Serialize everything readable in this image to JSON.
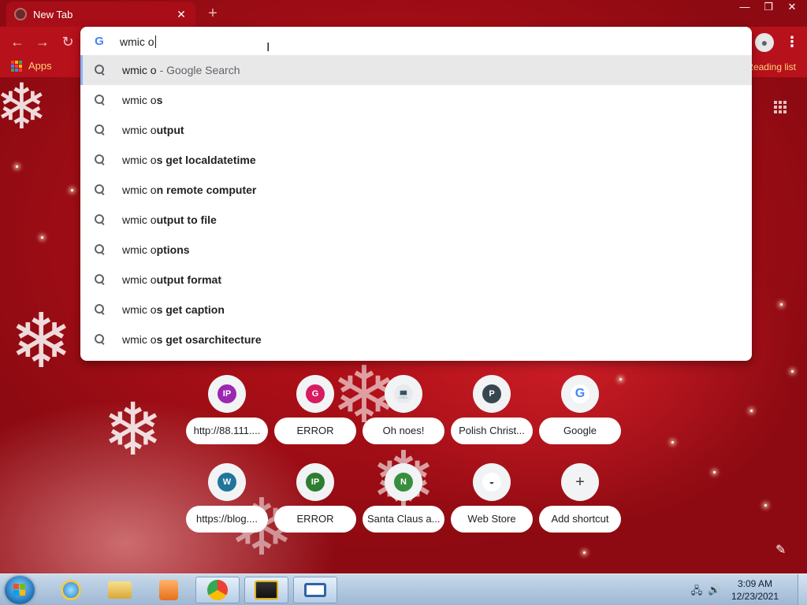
{
  "browser": {
    "tab": {
      "title": "New Tab",
      "close_label": "✕"
    },
    "new_tab_label": "+",
    "window_controls": {
      "minimize": "—",
      "maximize": "❐",
      "close": "✕"
    },
    "nav": {
      "back": "←",
      "forward": "→",
      "reload": "↻"
    },
    "profile_glyph": "●",
    "menu_glyph": "⋮"
  },
  "bookmarks": {
    "apps_label": "Apps",
    "reading_list_label": "Reading list"
  },
  "omnibox": {
    "google_glyph": "G",
    "value": "wmic o",
    "suggestions": [
      {
        "base": "wmic o",
        "rest": "",
        "suffix": "- Google Search",
        "selected": true
      },
      {
        "base": "wmic o",
        "rest": "s"
      },
      {
        "base": "wmic o",
        "rest": "utput"
      },
      {
        "base": "wmic o",
        "rest": "s get localdatetime"
      },
      {
        "base": "wmic o",
        "rest": "n remote computer"
      },
      {
        "base": "wmic o",
        "rest": "utput to file"
      },
      {
        "base": "wmic o",
        "rest": "ptions"
      },
      {
        "base": "wmic o",
        "rest": "utput format"
      },
      {
        "base": "wmic o",
        "rest": "s get caption"
      },
      {
        "base": "wmic o",
        "rest": "s get osarchitecture"
      }
    ]
  },
  "shortcuts": [
    {
      "label": "http://88.111....",
      "glyph": "IP",
      "color": "#9c27b0"
    },
    {
      "label": "ERROR",
      "glyph": "G",
      "color": "#d81b60"
    },
    {
      "label": "Oh noes!",
      "glyph": "💻",
      "color": "#e8eaed"
    },
    {
      "label": "Polish Christ...",
      "glyph": "P",
      "color": "#37474f"
    },
    {
      "label": "Google",
      "glyph": "G",
      "color": "#ffffff"
    },
    {
      "label": "https://blog....",
      "glyph": "W",
      "color": "#21759b"
    },
    {
      "label": "ERROR",
      "glyph": "IP",
      "color": "#2e7d32"
    },
    {
      "label": "Santa Claus a...",
      "glyph": "N",
      "color": "#388e3c"
    },
    {
      "label": "Web Store",
      "glyph": "◒",
      "color": "#ffffff"
    },
    {
      "label": "Add shortcut",
      "glyph": "+",
      "color": "#f1f3f4"
    }
  ],
  "taskbar": {
    "clock_time": "3:09 AM",
    "clock_date": "12/23/2021"
  },
  "colors": {
    "accent_blue": "#8ab4f8",
    "background_red": "#b01018"
  }
}
